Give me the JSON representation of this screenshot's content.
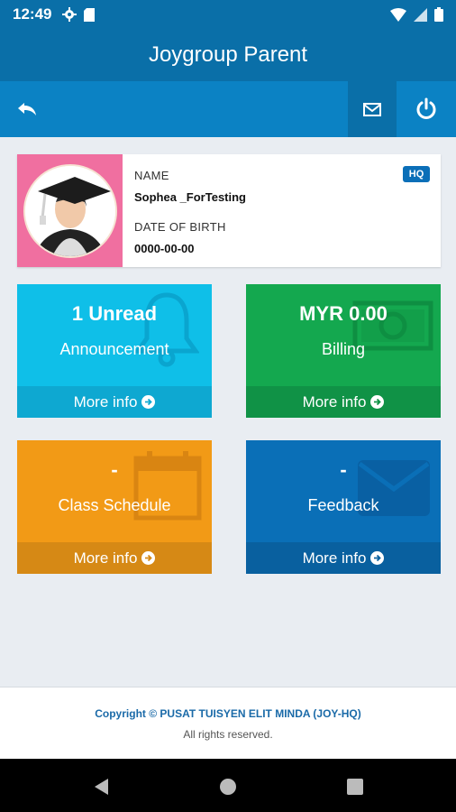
{
  "status_bar": {
    "time": "12:49"
  },
  "header": {
    "title_bold": "Joygroup",
    "title_rest": " Parent"
  },
  "profile": {
    "name_label": "NAME",
    "name_value": "Sophea _ForTesting",
    "dob_label": "DATE OF BIRTH",
    "dob_value": "0000-00-00",
    "badge": "HQ"
  },
  "tiles": [
    {
      "value": "1 Unread",
      "label": "Announcement",
      "more": "More info"
    },
    {
      "value": "MYR 0.00",
      "label": "Billing",
      "more": "More info"
    },
    {
      "value": "-",
      "label": "Class Schedule",
      "more": "More info"
    },
    {
      "value": "-",
      "label": "Feedback",
      "more": "More info"
    }
  ],
  "footer": {
    "copyright_prefix": "Copyright ©",
    "copyright_org": "PUSAT TUISYEN ELIT MINDA (JOY-HQ)",
    "rights": "All rights reserved."
  },
  "icons": {
    "back": "reply-icon",
    "mail": "envelope-icon",
    "power": "power-icon"
  },
  "colors": {
    "primary": "#0a6fa8",
    "toolbar": "#0b82c4",
    "announcement": "#0fbfe8",
    "billing": "#14a84f",
    "schedule": "#f29a16",
    "feedback": "#0a6fb7"
  }
}
